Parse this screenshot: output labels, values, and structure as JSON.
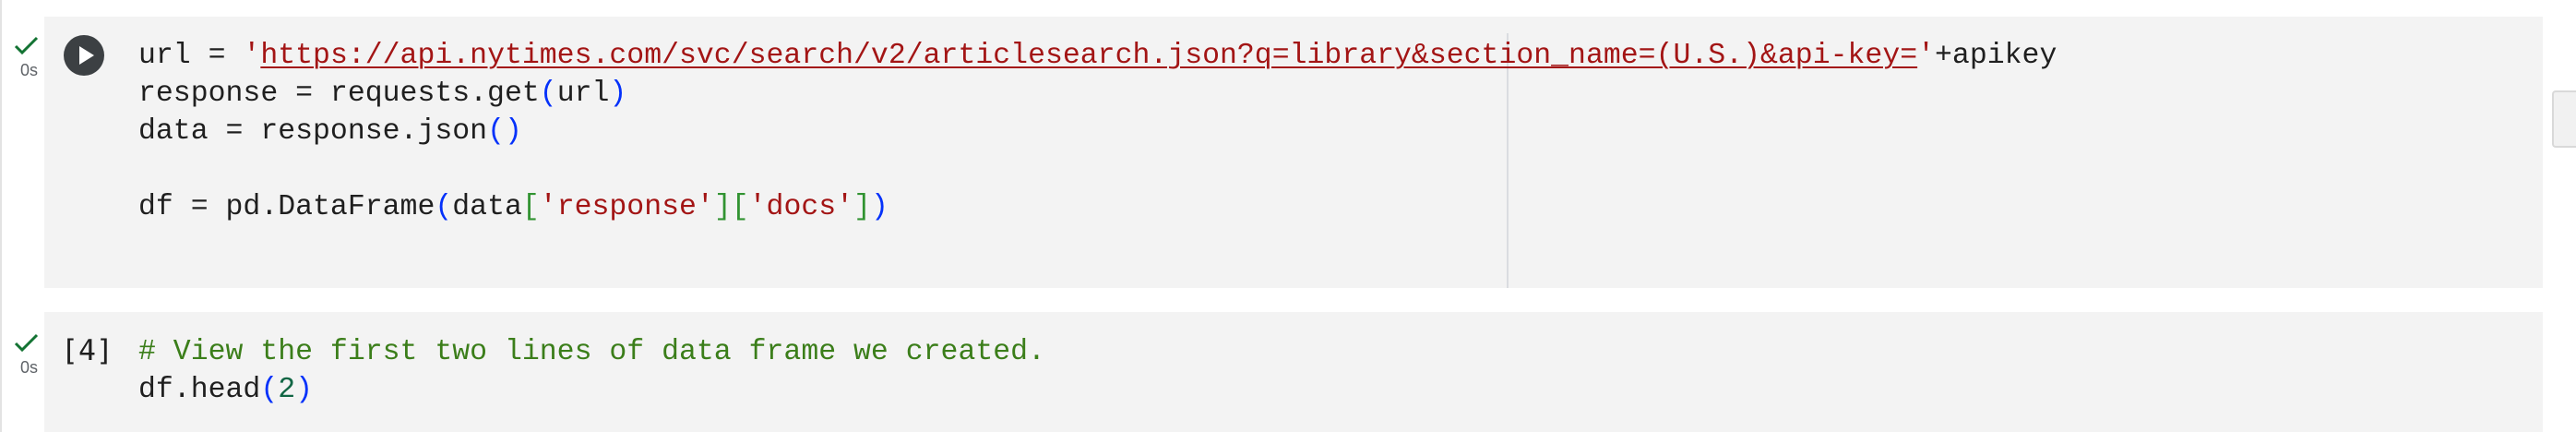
{
  "cells": [
    {
      "status": "✓",
      "time": "0s",
      "lines": {
        "l1_prefix": "url = ",
        "l1_quote_open": "'",
        "l1_url": "https://api.nytimes.com/svc/search/v2/articlesearch.json?q=library&section_name=(U.S.)&api-key=",
        "l1_quote_close": "'",
        "l1_suffix": "+apikey",
        "l2_a": "response = requests.get",
        "l2_b": "(",
        "l2_c": "url",
        "l2_d": ")",
        "l3_a": "data = response.json",
        "l3_b": "()",
        "l5_a": "df = pd.DataFrame",
        "l5_b": "(",
        "l5_c": "data",
        "l5_d": "[",
        "l5_e": "'response'",
        "l5_f": "]",
        "l5_g": "[",
        "l5_h": "'docs'",
        "l5_i": "]",
        "l5_j": ")"
      }
    },
    {
      "status": "✓",
      "time": "0s",
      "exec_count": "[4]",
      "lines": {
        "l1": "# View the first two lines of data frame we created.",
        "l2_a": "df.head",
        "l2_b": "(",
        "l2_c": "2",
        "l2_d": ")"
      }
    }
  ],
  "colors": {
    "string": "#a31515",
    "bracket": "#0431fa",
    "bracket_inner": "#319331",
    "number": "#116644",
    "comment": "#3b7e1a",
    "check": "#137333"
  },
  "icons": {
    "run": "play-circle-icon",
    "status": "checkmark-icon"
  }
}
